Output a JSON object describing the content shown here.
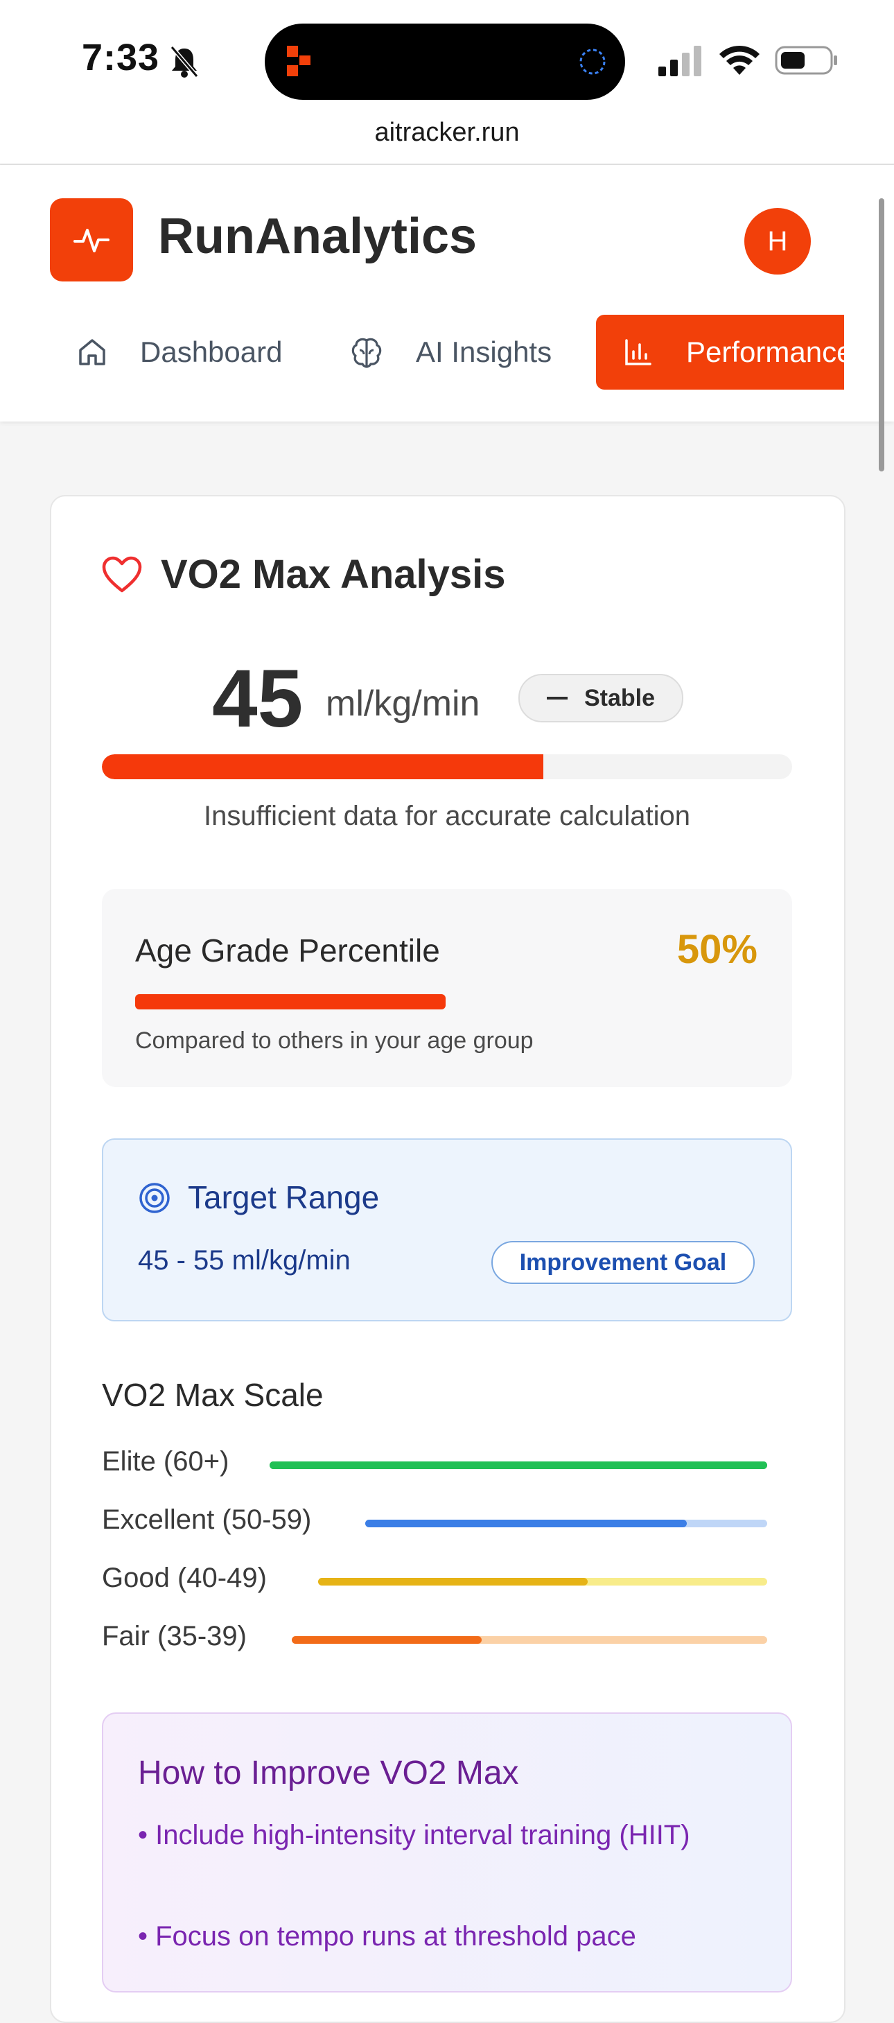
{
  "status_bar": {
    "time": "7:33",
    "url": "aitracker.run"
  },
  "app": {
    "brand": "RunAnalytics",
    "avatar_initial": "H",
    "accent_color": "#f2400a",
    "nav": [
      {
        "label": "Dashboard",
        "icon": "home-icon"
      },
      {
        "label": "AI Insights",
        "icon": "brain-icon"
      },
      {
        "label": "Performance",
        "icon": "bar-chart-icon",
        "active": true
      }
    ]
  },
  "vo2": {
    "title": "VO2 Max Analysis",
    "value": "45",
    "unit": "ml/kg/min",
    "trend": "Stable",
    "progress_fraction": 0.64,
    "note": "Insufficient data for accurate calculation"
  },
  "age_grade": {
    "label": "Age Grade Percentile",
    "value": "50%",
    "progress_fraction": 0.5,
    "caption": "Compared to others in your age group"
  },
  "target": {
    "title": "Target Range",
    "range": "45 - 55 ml/kg/min",
    "badge": "Improvement Goal"
  },
  "scale": {
    "title": "VO2 Max Scale",
    "rows": [
      {
        "label": "Elite (60+)",
        "fill_fraction": 1.0,
        "color": "#21c055",
        "track_color": "#21c055"
      },
      {
        "label": "Excellent (50-59)",
        "fill_fraction": 0.8,
        "color": "#3b7ee6",
        "track_color": "#bfd6f7"
      },
      {
        "label": "Good (40-49)",
        "fill_fraction": 0.6,
        "color": "#e6b316",
        "track_color": "#f8ec8a"
      },
      {
        "label": "Fair (35-39)",
        "fill_fraction": 0.4,
        "color": "#f26b18",
        "track_color": "#fbd1a6"
      }
    ]
  },
  "improve": {
    "title": "How to Improve VO2 Max",
    "tips": [
      "• Include high-intensity interval training (HIIT)",
      "• Focus on tempo runs at threshold pace"
    ]
  }
}
